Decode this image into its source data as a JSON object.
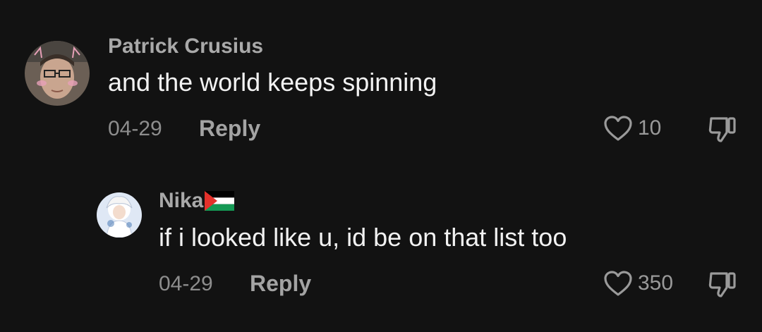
{
  "comments": [
    {
      "username": "Patrick Crusius",
      "text": "and the world keeps spinning",
      "date": "04-29",
      "reply_label": "Reply",
      "like_count": "10"
    },
    {
      "username": "Nika",
      "flag": "palestine-flag",
      "text": "if i looked like u, id be on that list too",
      "date": "04-29",
      "reply_label": "Reply",
      "like_count": "350"
    }
  ],
  "colors": {
    "background": "#121212",
    "username": "#a9a9a9",
    "text": "#f2f2f2",
    "meta": "#8d8d8d"
  }
}
